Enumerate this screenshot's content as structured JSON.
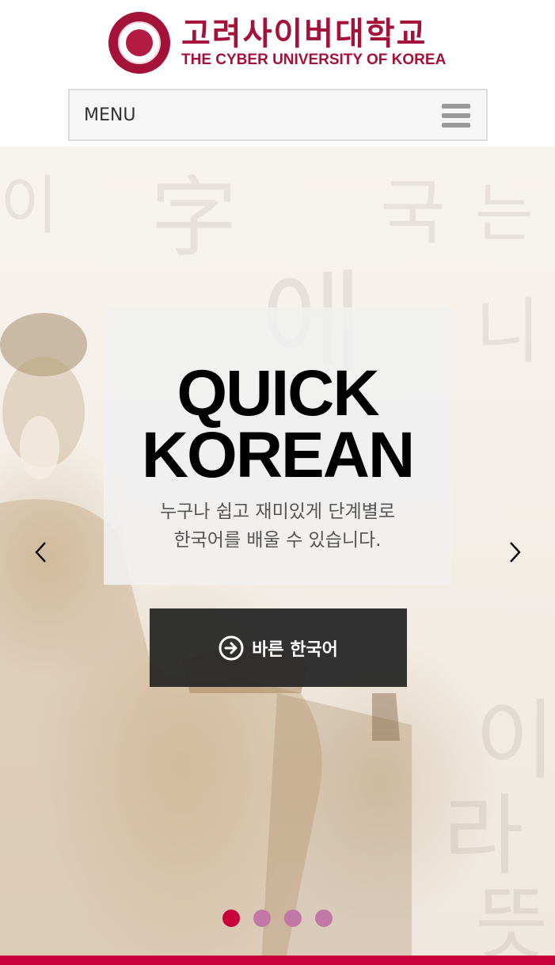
{
  "header": {
    "logo_korean": "고려사이버대학교",
    "logo_english": "THE CYBER UNIVERSITY OF KOREA"
  },
  "menu": {
    "label": "MENU",
    "icon": "hamburger-icon"
  },
  "slider": {
    "headline_line1": "QUICK",
    "headline_line2": "KOREAN",
    "subtitle_line1": "누구나 쉽고 재미있게 단계별로",
    "subtitle_line2": "한국어를 배울 수 있습니다.",
    "cta_label": "바른 한국어",
    "cta_icon": "arrow-circle-right-icon",
    "prev_icon": "chevron-left-icon",
    "next_icon": "chevron-right-icon",
    "total_slides": 4,
    "active_slide": 1
  },
  "colors": {
    "brand": "#a4123a",
    "accent": "#c8003c",
    "dot_inactive": "#c278a6"
  }
}
